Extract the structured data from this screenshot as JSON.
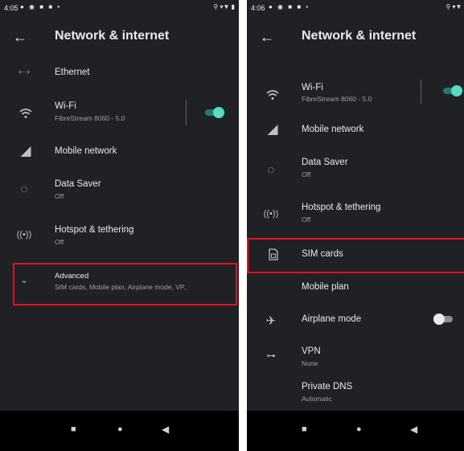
{
  "left": {
    "status_bar": {
      "time": "4:05",
      "status_icons": "● ◉ ■ ■ •",
      "system_icons": "⚲ ▾▼ ▮"
    },
    "app_bar": {
      "title": "Network & internet"
    },
    "items": {
      "ethernet": {
        "title": "Ethernet",
        "icon": "ethernet-icon"
      },
      "wifi": {
        "title": "Wi-Fi",
        "subtitle": "FibreStream 8060 - 5.0",
        "icon": "wifi-icon",
        "toggle_on": true
      },
      "mobile_network": {
        "title": "Mobile network",
        "icon": "signal-icon"
      },
      "data_saver": {
        "title": "Data Saver",
        "subtitle": "Off",
        "icon": "data-saver-icon"
      },
      "hotspot": {
        "title": "Hotspot & tethering",
        "subtitle": "Off",
        "icon": "hotspot-icon"
      },
      "advanced": {
        "title": "Advanced",
        "subtitle": "SIM cards, Mobile plan, Airplane mode, VP..",
        "icon": "chevron-down-icon"
      }
    }
  },
  "right": {
    "status_bar": {
      "time": "4:06",
      "status_icons": "● ◉ ■ ■ •",
      "system_icons": "⚲ ▾▼ ▮"
    },
    "app_bar": {
      "title": "Network & internet"
    },
    "items": {
      "wifi": {
        "title": "Wi-Fi",
        "subtitle": "FibreStream 8060 - 5.0",
        "icon": "wifi-icon",
        "toggle_on": true
      },
      "mobile_network": {
        "title": "Mobile network",
        "icon": "signal-icon"
      },
      "data_saver": {
        "title": "Data Saver",
        "subtitle": "Off",
        "icon": "data-saver-icon"
      },
      "hotspot": {
        "title": "Hotspot & tethering",
        "subtitle": "Off",
        "icon": "hotspot-icon"
      },
      "sim_cards": {
        "title": "SIM cards",
        "icon": "sim-card-icon"
      },
      "mobile_plan": {
        "title": "Mobile plan"
      },
      "airplane": {
        "title": "Airplane mode",
        "icon": "airplane-icon",
        "toggle_on": false
      },
      "vpn": {
        "title": "VPN",
        "subtitle": "None",
        "icon": "vpn-key-icon"
      },
      "private_dns": {
        "title": "Private DNS",
        "subtitle": "Automatic"
      }
    }
  },
  "colors": {
    "background": "#202124",
    "highlight": "#e0141e",
    "toggle_on": "#5bd8c6",
    "nav_bar": "#000000"
  }
}
